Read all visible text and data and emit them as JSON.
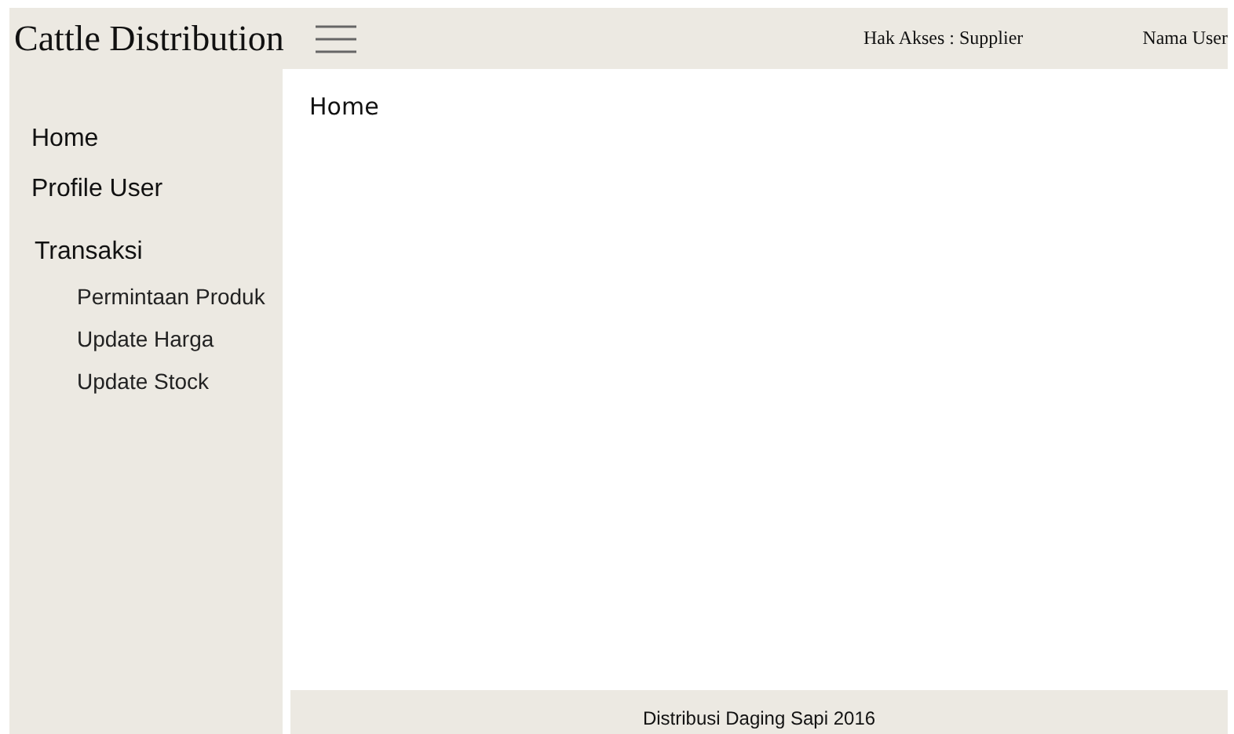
{
  "header": {
    "title": "Cattle Distribution",
    "access": "Hak Akses : Supplier",
    "user": "Nama User"
  },
  "sidebar": {
    "items": [
      {
        "label": "Home"
      },
      {
        "label": "Profile User"
      },
      {
        "label": "Transaksi",
        "children": [
          {
            "label": "Permintaan Produk"
          },
          {
            "label": "Update Harga"
          },
          {
            "label": "Update Stock"
          }
        ]
      }
    ]
  },
  "main": {
    "heading": "Home"
  },
  "footer": {
    "text": "Distribusi Daging Sapi 2016"
  }
}
